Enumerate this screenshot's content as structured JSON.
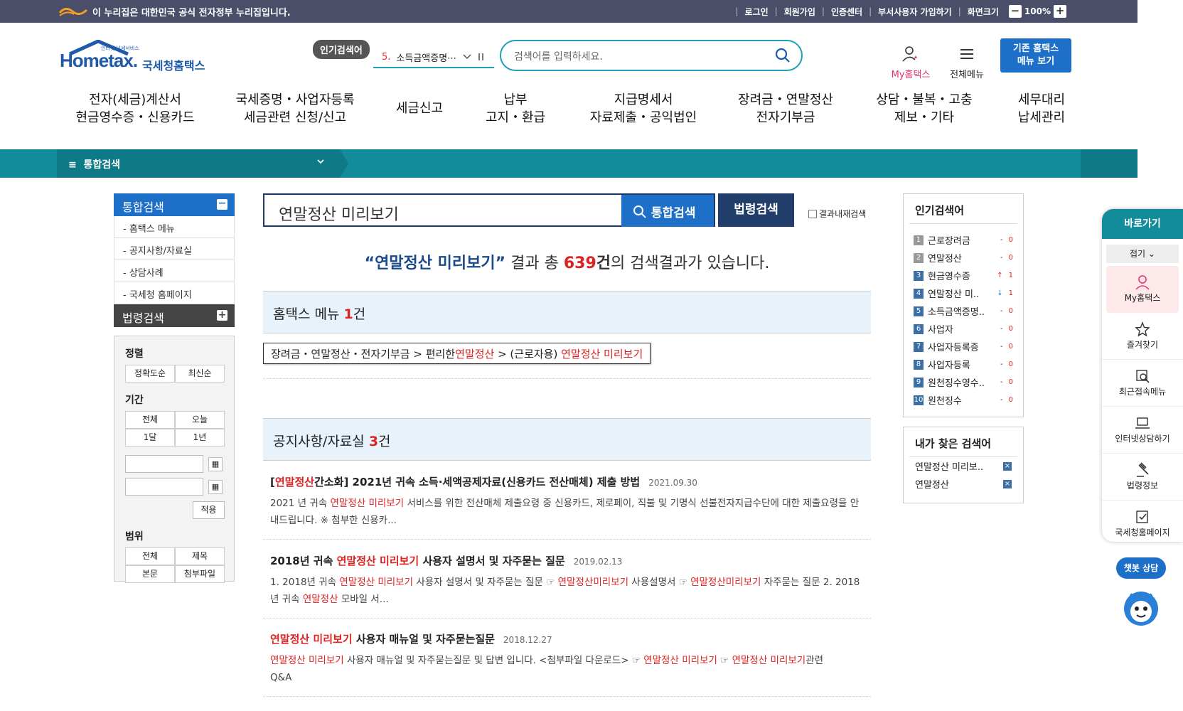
{
  "topbar": {
    "notice": "이 누리집은 대한민국 공식 전자정부 누리집입니다.",
    "links": [
      "로그인",
      "회원가입",
      "인증센터",
      "부서사용자 가입하기"
    ],
    "zoom_label": "화면크기",
    "zoom_value": "100%"
  },
  "header": {
    "logo_small": "인터넷 납세서비스",
    "logo_text": "Hometax.",
    "logo_kname": "국세청홈택스",
    "popular_badge": "인기검색어",
    "popular_roll_num": "5.",
    "popular_roll_text": "소득금액증명⋯",
    "search_placeholder": "검색어를 입력하세요.",
    "my_hometax": "My홈택스",
    "all_menu": "전체메뉴",
    "old_btn_l1": "기존 홈택스",
    "old_btn_l2": "메뉴 보기",
    "colors": {
      "accent": "#1e9fb5",
      "brand": "#1d6fc7",
      "red": "#d22222"
    }
  },
  "gnb": [
    {
      "l1": "전자(세금)계산서",
      "l2": "현금영수증・신용카드"
    },
    {
      "l1": "국세증명・사업자등록",
      "l2": "세금관련 신청/신고"
    },
    {
      "l1": "세금신고",
      "l2": ""
    },
    {
      "l1": "납부",
      "l2": "고지・환급"
    },
    {
      "l1": "지급명세서",
      "l2": "자료제출・공익법인"
    },
    {
      "l1": "장려금・연말정산",
      "l2": "전자기부금"
    },
    {
      "l1": "상담・불복・고충",
      "l2": "제보・기타"
    },
    {
      "l1": "세무대리",
      "l2": "납세관리"
    }
  ],
  "subbar": {
    "label": "통합검색"
  },
  "lnb": {
    "head": "통합검색",
    "items": [
      "- 홈택스 메뉴",
      "- 공지사항/자료실",
      "- 상담사례",
      "- 국세청 홈페이지"
    ],
    "law_head": "법령검색"
  },
  "filter": {
    "sort_title": "정렬",
    "sort": [
      "정확도순",
      "최신순"
    ],
    "period_title": "기간",
    "period": [
      "전체",
      "오늘",
      "1달",
      "1년"
    ],
    "apply": "적용",
    "scope_title": "범위",
    "scope": [
      "전체",
      "제목",
      "본문",
      "첨부파일"
    ]
  },
  "search": {
    "query": "연말정산 미리보기",
    "button": "통합검색",
    "law_button": "법령검색",
    "in_result": "결과내재검색"
  },
  "summary": {
    "open_quote": "“",
    "keyword": "연말정산 미리보기",
    "close_quote": "”",
    "pre": " 결과 총 ",
    "count": "639",
    "unit": "건",
    "post": "의 검색결과가 있습니다."
  },
  "sections": {
    "menu": {
      "title": "홈택스 메뉴 ",
      "count": "1",
      "unit": "건"
    },
    "notice": {
      "title": "공지사항/자료실 ",
      "count": "3",
      "unit": "건"
    }
  },
  "menu_path": {
    "p1": "장려금・연말정산・전자기부금 > 편리한",
    "h1": "연말정산",
    "p2": " > (근로자용) ",
    "h2": "연말정산 미리보기"
  },
  "results": [
    {
      "t_pre": "[",
      "t_hl": "연말정산",
      "t_post": "간소화] 2021년 귀속 소득·세액공제자료(신용카드 전산매체) 제출 방법",
      "date": "2021.09.30",
      "b1": "2021 년 귀속 ",
      "b_hl1": "연말정산 미리보기",
      "b2": " 서비스를 위한 전산매체 제출요령 중 신용카드, 제로페이, 직불 및 기명식 선불전자지급수단에 대한 제출요령을 안내드립니다. ※ 첨부한 신용카..."
    },
    {
      "t_pre": "2018년 귀속 ",
      "t_hl": "연말정산 미리보기",
      "t_post": " 사용자 설명서 및 자주묻는 질문",
      "date": "2019.02.13",
      "b1": "1. 2018년 귀속 ",
      "b_hl1": "연말정산 미리보기",
      "b2": " 사용자 설명서 및 자주묻는 질문 ☞ ",
      "b_hl2": "연말정산미리보기",
      "b3": " 사용설명서 ☞ ",
      "b_hl3": "연말정산미리보기",
      "b4": " 자주묻는 질문 2. 2018년 귀속 ",
      "b_hl4": "연말정산",
      "b5": " 모바일 서..."
    },
    {
      "t_pre": "",
      "t_hl": "연말정산 미리보기",
      "t_post": " 사용자 매뉴얼 및 자주묻는질문",
      "date": "2018.12.27",
      "b_hl1": "연말정산 미리보기",
      "b2": " 사용자 매뉴얼 및 자주묻는질문 및 답변 입니다. <첨부파일 다운로드> ☞ ",
      "b_hl2": "연말정산 미리보기",
      "b3": " ☞ ",
      "b_hl3": "연말정산 미리보기",
      "b4": "관련 Q&A"
    }
  ],
  "popular": {
    "title": "인기검색어",
    "items": [
      {
        "n": "1",
        "t": "근로장려금",
        "d": "-",
        "v": "0"
      },
      {
        "n": "2",
        "t": "연말정산",
        "d": "-",
        "v": "0"
      },
      {
        "n": "3",
        "t": "현금영수증",
        "d": "↑",
        "v": "1"
      },
      {
        "n": "4",
        "t": "연말정산 미..",
        "d": "↓",
        "v": "1"
      },
      {
        "n": "5",
        "t": "소득금액증명..",
        "d": "-",
        "v": "0"
      },
      {
        "n": "6",
        "t": "사업자",
        "d": "-",
        "v": "0"
      },
      {
        "n": "7",
        "t": "사업자등록증",
        "d": "-",
        "v": "0"
      },
      {
        "n": "8",
        "t": "사업자등록",
        "d": "-",
        "v": "0"
      },
      {
        "n": "9",
        "t": "원천징수영수..",
        "d": "-",
        "v": "0"
      },
      {
        "n": "10",
        "t": "원천징수",
        "d": "-",
        "v": "0"
      }
    ]
  },
  "my_search": {
    "title": "내가 찾은 검색어",
    "items": [
      "연말정산 미리보..",
      "연말정산"
    ]
  },
  "quick": {
    "title": "바로가기",
    "fold": "접기",
    "items": [
      "My홈택스",
      "즐겨찾기",
      "최근접속메뉴",
      "인터넷상담하기",
      "법령정보",
      "국세청홈페이지"
    ]
  },
  "chatbot": "챗봇 상담"
}
